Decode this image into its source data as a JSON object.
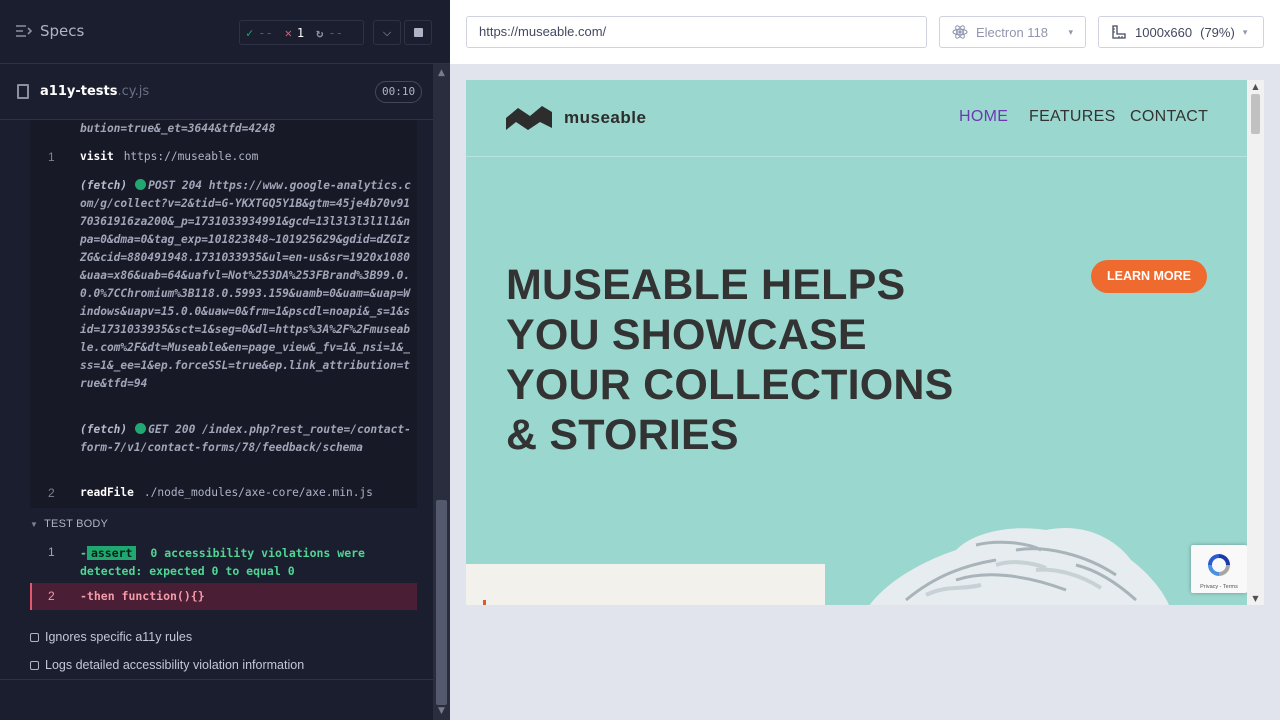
{
  "runner": {
    "specs_label": "Specs",
    "stats": {
      "passed": "--",
      "failed": "1",
      "pending": "--"
    },
    "file": {
      "name": "a11y-tests",
      "ext": ".cy.js",
      "duration": "00:10"
    },
    "log": {
      "top_fragment": "bution=true&_et=3644&tfd=4248",
      "rows": [
        {
          "num": "1",
          "cmd": "visit",
          "arg": "https://museable.com"
        },
        {
          "num": "2",
          "cmd": "readFile",
          "arg": "./node_modules/axe-core/axe.min.js"
        }
      ],
      "fetch1_prefix": "(fetch)",
      "fetch1_text": "POST 204 https://www.google-analytics.com/g/collect?v=2&tid=G-YKXTGQ5Y1B&gtm=45je4b70v9170361916za200&_p=1731033934991&gcd=13l3l3l3l1l1&npa=0&dma=0&tag_exp=101823848~101925629&gdid=dZGIzZG&cid=880491948.1731033935&ul=en-us&sr=1920x1080&uaa=x86&uab=64&uafvl=Not%253DA%253FBrand%3B99.0.0.0%7CChromium%3B118.0.5993.159&uamb=0&uam=&uap=Windows&uapv=15.0.0&uaw=0&frm=1&pscdl=noapi&_s=1&sid=1731033935&sct=1&seg=0&dl=https%3A%2F%2Fmuseable.com%2F&dt=Museable&en=page_view&_fv=1&_nsi=1&_ss=1&_ee=1&ep.forceSSL=true&ep.link_attribution=true&tfd=94",
      "fetch2_prefix": "(fetch)",
      "fetch2_text": "GET 200 /index.php?rest_route=/contact-form-7/v1/contact-forms/78/feedback/schema"
    },
    "test_body": {
      "label": "TEST BODY",
      "assert_num": "1",
      "assert_dash": "-",
      "assert_badge": "assert",
      "assert_text": "0 accessibility violations were detected: expected 0 to equal 0",
      "then_num": "2",
      "then_text": "-then  function(){}"
    },
    "tests": [
      "Ignores specific a11y rules",
      "Logs detailed accessibility violation information"
    ]
  },
  "preview": {
    "url": "https://museable.com/",
    "browser": "Electron 118",
    "viewport": "1000x660",
    "zoom": "(79%)"
  },
  "site": {
    "logo_text": "museable",
    "nav": [
      "HOME",
      "FEATURES",
      "CONTACT"
    ],
    "hero_lines": [
      "MUSEABLE HELPS",
      "YOU SHOWCASE",
      "YOUR COLLECTIONS",
      "& STORIES"
    ],
    "cta": "LEARN MORE",
    "recaptcha_label": "Privacy - Terms"
  },
  "colors": {
    "runner_bg": "#1b1e2e",
    "pass": "#1fa971",
    "fail": "#e45770",
    "site_bg": "#9ad7cf",
    "cta": "#ee6a2e",
    "nav_active": "#6b3ab0"
  }
}
